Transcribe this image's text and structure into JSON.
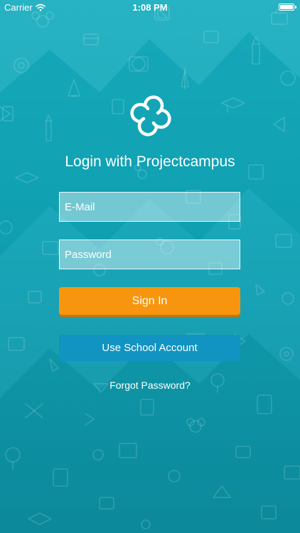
{
  "status_bar": {
    "carrier": "Carrier",
    "time": "1:08 PM",
    "battery_level": 1.0,
    "wifi_icon": "wifi-icon"
  },
  "login": {
    "logo_icon": "projectcampus-logo-icon",
    "title": "Login with Projectcampus",
    "email_placeholder": "E-Mail",
    "email_value": "",
    "password_placeholder": "Password",
    "password_value": "",
    "sign_in_label": "Sign In",
    "school_account_label": "Use School Account",
    "forgot_password_label": "Forgot Password?"
  },
  "colors": {
    "background_top": "#17aebf",
    "background_bottom": "#0d8fa0",
    "sign_in_button": "#f7960e",
    "school_button": "#1194c2",
    "text": "#ffffff"
  }
}
